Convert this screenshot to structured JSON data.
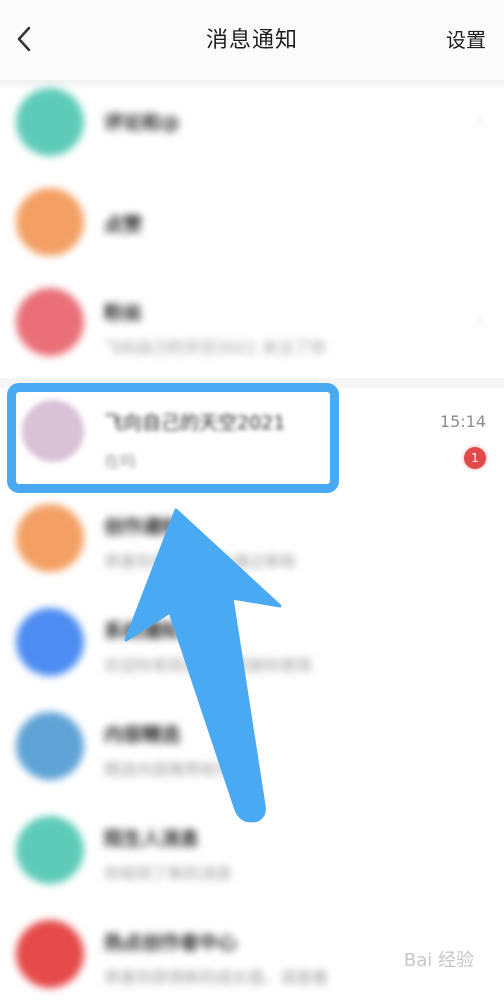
{
  "header": {
    "title": "消息通知",
    "settings_label": "设置"
  },
  "items": [
    {
      "name": "评论和@",
      "sub": "",
      "meta": "",
      "avatar_color": "#5ecbb8"
    },
    {
      "name": "点赞",
      "sub": "",
      "meta": "",
      "avatar_color": "#f4a064"
    },
    {
      "name": "粉丝",
      "sub": "飞向自己的天空2021 关注了你",
      "meta": "",
      "avatar_color": "#ea6f78"
    },
    {
      "name": "飞向自己的天空2021",
      "sub": "在吗",
      "time": "15:14",
      "badge": "1",
      "avatar_color": "#d9c1d6"
    },
    {
      "name": "创作通知",
      "sub": "恭喜你发布的作品通过审核",
      "meta": "",
      "avatar_color": "#f4a064"
    },
    {
      "name": "系统通知",
      "sub": "欢迎你来到这里，感谢你使用",
      "meta": "",
      "avatar_color": "#4d8cf2"
    },
    {
      "name": "内容精选",
      "sub": "精选内容推荐给你",
      "meta": "",
      "avatar_color": "#5fa3d6"
    },
    {
      "name": "陌生人消息",
      "sub": "你收到了新的消息",
      "meta": "",
      "avatar_color": "#5ecbb8"
    },
    {
      "name": "热点创作者中心",
      "sub": "恭喜你获得新的成长值，请查看",
      "meta": "",
      "avatar_color": "#e64a4a"
    }
  ],
  "watermark": "Bai 经验",
  "colors": {
    "highlight": "#4aa9f3",
    "badge": "#e24a4a"
  },
  "icons": {
    "back": "back-chevron-icon",
    "arrow": "pointer-arrow"
  }
}
